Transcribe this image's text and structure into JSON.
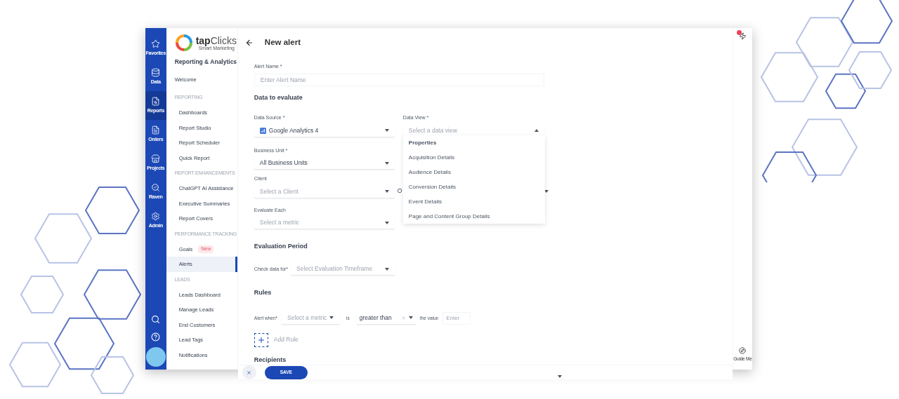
{
  "rail": {
    "items": [
      {
        "label": "Favorites",
        "selected": false
      },
      {
        "label": "Data",
        "selected": false
      },
      {
        "label": "Reports",
        "selected": true
      },
      {
        "label": "Orders",
        "selected": false
      },
      {
        "label": "Projects",
        "selected": false
      },
      {
        "label": "Raven",
        "selected": false
      },
      {
        "label": "Admin",
        "selected": false
      }
    ]
  },
  "sidebar": {
    "brand": {
      "name_bold": "tap",
      "name_light": "Clicks",
      "tagline": "Smart Marketing"
    },
    "title": "Reporting & Analytics",
    "items": [
      {
        "kind": "top",
        "label": "Welcome",
        "selected": false
      },
      {
        "kind": "heading",
        "label": "REPORTING"
      },
      {
        "kind": "item",
        "label": "Dashboards",
        "selected": false
      },
      {
        "kind": "item",
        "label": "Report Studio",
        "selected": false
      },
      {
        "kind": "item",
        "label": "Report Scheduler",
        "selected": false
      },
      {
        "kind": "item",
        "label": "Quick Report",
        "selected": false
      },
      {
        "kind": "heading",
        "label": "REPORT ENHANCEMENTS"
      },
      {
        "kind": "item",
        "label": "ChatGPT AI Assistance",
        "selected": false
      },
      {
        "kind": "item",
        "label": "Executive Summaries",
        "selected": false
      },
      {
        "kind": "item",
        "label": "Report Covers",
        "selected": false
      },
      {
        "kind": "heading",
        "label": "PERFORMANCE TRACKING"
      },
      {
        "kind": "item",
        "label": "Goals",
        "badge": "New",
        "selected": false
      },
      {
        "kind": "item",
        "label": "Alerts",
        "selected": true
      },
      {
        "kind": "heading",
        "label": "LEADS"
      },
      {
        "kind": "item",
        "label": "Leads Dashboard",
        "selected": false
      },
      {
        "kind": "item",
        "label": "Manage Leads",
        "selected": false
      },
      {
        "kind": "item",
        "label": "End Customers",
        "selected": false
      },
      {
        "kind": "item",
        "label": "Lead Tags",
        "selected": false
      },
      {
        "kind": "item",
        "label": "Notifications",
        "selected": false
      }
    ]
  },
  "page": {
    "title": "New alert"
  },
  "form": {
    "alert_name": {
      "label": "Alert Name *",
      "placeholder": "Enter Alert Name"
    },
    "data_heading": "Data to evaluate",
    "data_source": {
      "label": "Data Source *",
      "value": "Google Analytics 4"
    },
    "data_view": {
      "label": "Data View *",
      "placeholder": "Select a data view",
      "expanded": true,
      "options": [
        {
          "label": "Properties",
          "kind": "group"
        },
        {
          "label": "Acquisition Details",
          "kind": "option"
        },
        {
          "label": "Audience Details",
          "kind": "option"
        },
        {
          "label": "Conversion Details",
          "kind": "option"
        },
        {
          "label": "Event Details",
          "kind": "option"
        },
        {
          "label": "Page and Content Group Details",
          "kind": "option"
        }
      ]
    },
    "business_unit": {
      "label": "Business Unit *",
      "value": "All Business Units"
    },
    "client": {
      "label": "Client",
      "placeholder": "Select a Client"
    },
    "client_row_right": {
      "value": "O"
    },
    "evaluate_each": {
      "label": "Evaluate Each",
      "placeholder": "Select a metric"
    },
    "period_heading": "Evaluation Period",
    "check_data": {
      "label": "Check data for*",
      "placeholder": "Select Evaluation Timeframe"
    },
    "rules_heading": "Rules",
    "rule": {
      "label": "Alert when*",
      "metric_placeholder": "Select a metric",
      "is": "is",
      "operator": "greater than",
      "value_label": "the value",
      "value_placeholder": "Enter"
    },
    "add_rule": "Add Rule",
    "recipients_heading": "Recipients"
  },
  "footer": {
    "save": "SAVE"
  },
  "right_rail": {
    "guide": "Guide Me",
    "notification_dot": true
  }
}
